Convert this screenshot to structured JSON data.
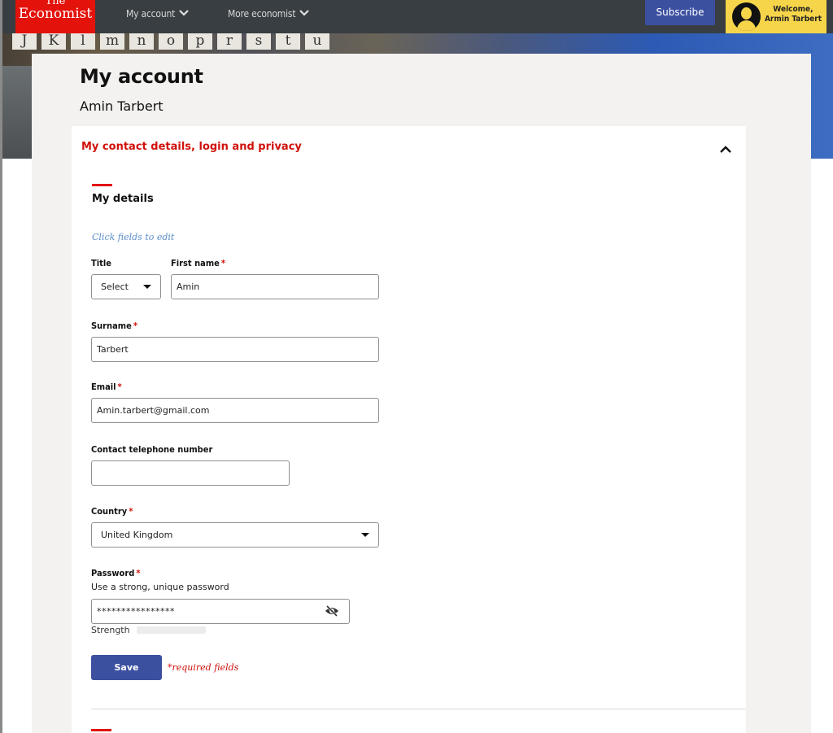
{
  "nav": {
    "logo_line1": "The",
    "logo_line2": "Economist",
    "my_account": "My account",
    "more_economist": "More economist",
    "subscribe": "Subscribe",
    "welcome_line1": "Welcome,",
    "welcome_line2": "Armin Tarbert"
  },
  "hero": {
    "tiles": [
      "J",
      "K",
      "l",
      "m",
      "n",
      "o",
      "p",
      "r",
      "s",
      "t",
      "u"
    ]
  },
  "page": {
    "title": "My account",
    "user_name": "Amin Tarbert"
  },
  "panel": {
    "heading": "My contact details, login and privacy"
  },
  "details": {
    "section_title": "My details",
    "hint": "Click fields to edit",
    "title_label": "Title",
    "title_value": "Select",
    "first_name_label": "First name",
    "first_name_value": "Amin",
    "surname_label": "Surname",
    "surname_value": "Tarbert",
    "email_label": "Email",
    "email_value": "Amin.tarbert@gmail.com",
    "phone_label": "Contact telephone number",
    "phone_value": "",
    "country_label": "Country",
    "country_value": "United Kingdom",
    "password_label": "Password",
    "password_helper": "Use a strong, unique password",
    "password_value": "****************",
    "strength_label": "Strength",
    "required_marker": "*",
    "save_label": "Save",
    "required_note": "*required fields"
  },
  "colors": {
    "brand_red": "#e3120b",
    "button_blue": "#3c50a0",
    "welcome_yellow": "#f6d54a",
    "hint_blue": "#5a8ec7"
  },
  "icons": {
    "nav_chevron": "chevron-down-icon",
    "panel_toggle": "chevron-up-icon",
    "password_toggle": "eye-slash-icon",
    "avatar": "user-avatar-icon"
  }
}
